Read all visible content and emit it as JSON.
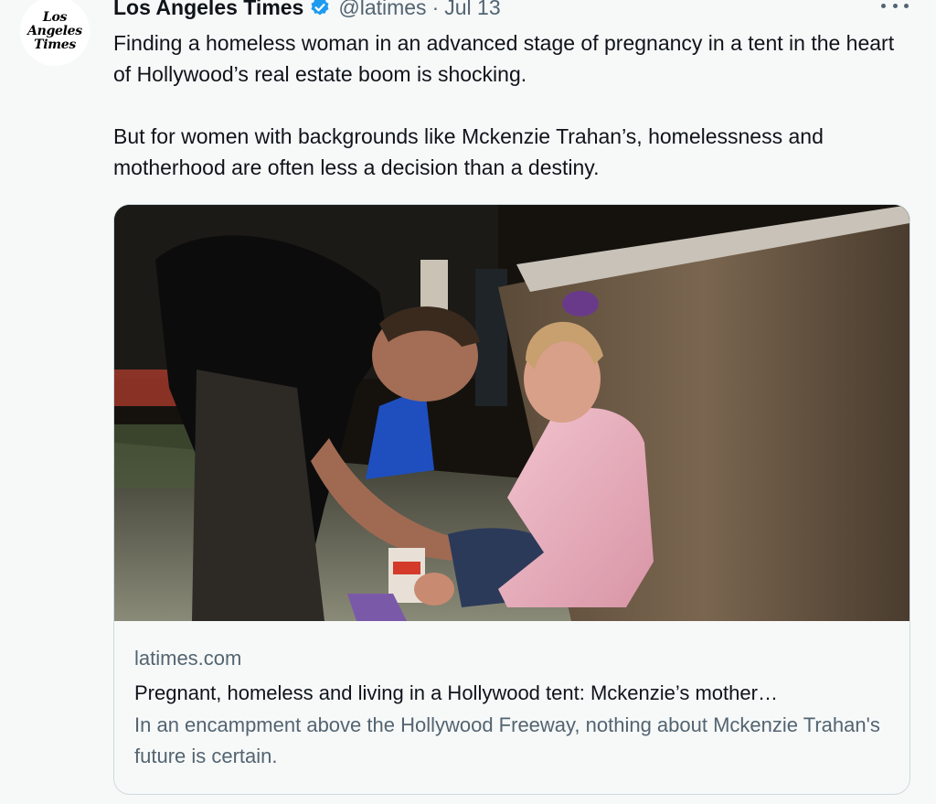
{
  "tweet": {
    "author_name": "Los Angeles Times",
    "handle": "@latimes",
    "separator": "·",
    "date": "Jul 13",
    "avatar_logo": [
      "Los",
      "Angeles",
      "Times"
    ],
    "verified_icon": "verified-badge-icon",
    "more_icon": "more-horizontal-icon",
    "text_paragraphs": [
      "Finding a homeless woman in an advanced stage of pregnancy in a tent in the heart of Hollywood’s real estate boom is shocking.",
      "But for women with backgrounds like Mckenzie Trahan’s, homelessness and motherhood are often less a decision than a destiny."
    ],
    "card": {
      "domain": "latimes.com",
      "title": "Pregnant, homeless and living in a Hollywood tent: Mckenzie’s mother…",
      "description": "In an encampment above the Hollywood Freeway, nothing about Mckenzie Trahan's future is certain."
    }
  },
  "colors": {
    "background": "#f7f9f9",
    "primary_text": "#0f1419",
    "secondary_text": "#536471",
    "verified_blue": "#1d9bf0",
    "card_border": "#cfd9de"
  }
}
